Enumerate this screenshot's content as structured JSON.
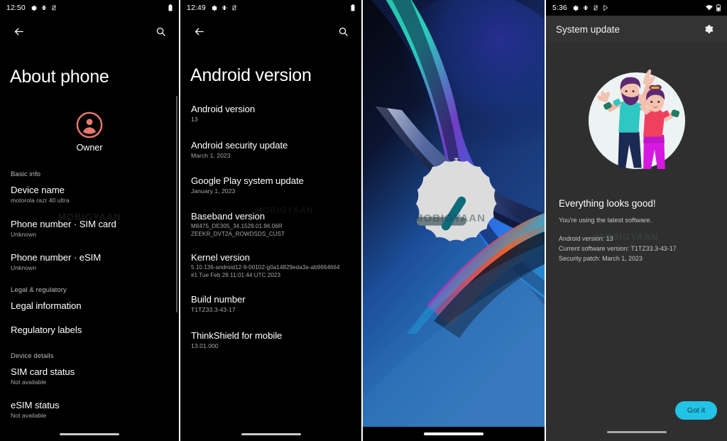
{
  "panels": {
    "about_phone": {
      "status": {
        "time": "12:50",
        "icons": [
          "gear-icon",
          "vibrate-icon",
          "mute-icon"
        ],
        "right_icons": [
          "battery-icon"
        ]
      },
      "nav": {
        "back_label": "←",
        "search_label": "search"
      },
      "title": "About phone",
      "account": {
        "name": "Owner"
      },
      "sections": [
        {
          "label": "Basic info",
          "rows": [
            {
              "title": "Device name",
              "value": "motorola razr 40 ultra"
            },
            {
              "title": "Phone number · SIM card",
              "value": "Unknown"
            },
            {
              "title": "Phone number · eSIM",
              "value": "Unknown"
            }
          ]
        },
        {
          "label": "Legal & regulatory",
          "rows": [
            {
              "title": "Legal information",
              "value": ""
            },
            {
              "title": "Regulatory labels",
              "value": ""
            }
          ]
        },
        {
          "label": "Device details",
          "rows": [
            {
              "title": "SIM card status",
              "value": "Not available"
            },
            {
              "title": "eSIM status",
              "value": "Not available"
            }
          ]
        }
      ],
      "watermark": "MOBIGYAAN"
    },
    "android_version": {
      "status": {
        "time": "12:49",
        "icons": [
          "gear-icon",
          "vibrate-icon",
          "mute-icon"
        ],
        "right_icons": [
          "battery-icon"
        ]
      },
      "title": "Android version",
      "rows": [
        {
          "title": "Android version",
          "value": "13"
        },
        {
          "title": "Android security update",
          "value": "March 1, 2023"
        },
        {
          "title": "Google Play system update",
          "value": "January 1, 2023"
        },
        {
          "title": "Baseband version",
          "value": "M8475_DE305_34.1529.01.96.06R\nZEEKR_DVT2A_ROWDSDS_CUST"
        },
        {
          "title": "Kernel version",
          "value": "5.10.136-android12-9-00102-g0a14829eda3a-ab9664664\n#1 Tue Feb 28 11:01:44 UTC 2023"
        },
        {
          "title": "Build number",
          "value": "T1TZ33.3-43-17"
        },
        {
          "title": "ThinkShield for mobile",
          "value": "13.01.000"
        }
      ],
      "watermark": "MOBIGYAAN"
    },
    "home_screen": {
      "widget": {
        "name": "clock-widget",
        "hour_hand_color": "#0e6b7a",
        "minute_hand_color": "#6e7d82",
        "face_color": "#dcdcdc"
      },
      "wallpaper_colors": [
        "#060813",
        "#12204d",
        "#1f6fd0",
        "#29bdf2",
        "#2bd5c0",
        "#f05a28",
        "#8c3fb5"
      ],
      "watermark": "MOBIGYAAN"
    },
    "system_update": {
      "status": {
        "time": "5:36",
        "icons": [
          "gear-icon",
          "vibrate-icon",
          "mute-icon",
          "play-store-icon"
        ],
        "right_icons": [
          "wifi-icon",
          "battery-icon"
        ]
      },
      "app_bar": {
        "title": "System update",
        "settings_label": "settings"
      },
      "illustration": "celebration-illustration",
      "heading": "Everything looks good!",
      "subheading": "You're using the latest software.",
      "details": [
        "Android version: 13",
        "Current software version: T1TZ33.3-43-17",
        "Security patch: March 1, 2023"
      ],
      "primary_button": "Got it",
      "accent_color": "#22c3e6",
      "watermark": "MOBIGYAAN"
    }
  }
}
